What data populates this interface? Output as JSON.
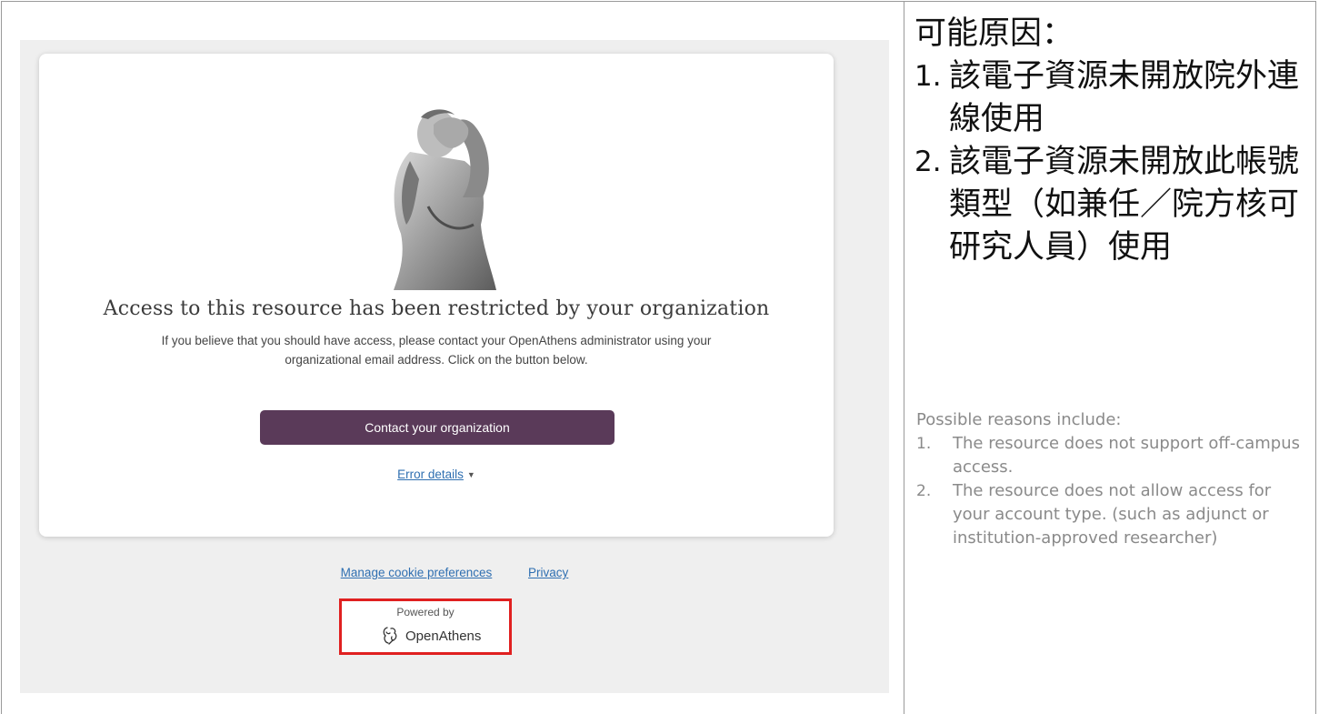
{
  "screenshot": {
    "headline": "Access to this resource has been restricted by your organization",
    "description_line1": "If you believe that you should have access, please contact your OpenAthens administrator using your",
    "description_line2": "organizational email address. Click on the button below.",
    "contact_button": "Contact your organization",
    "error_details": "Error details",
    "footer": {
      "cookie_link": "Manage cookie preferences",
      "privacy_link": "Privacy"
    },
    "powered_by": "Powered by",
    "brand": "OpenAthens"
  },
  "notes_zh": {
    "title": "可能原因：",
    "items": [
      {
        "num": "1.",
        "text": "該電子資源未開放院外連線使用"
      },
      {
        "num": "2.",
        "text": "該電子資源未開放此帳號類型（如兼任／院方核可研究人員）使用"
      }
    ]
  },
  "notes_en": {
    "title": "Possible reasons include:",
    "items": [
      {
        "num": "1.",
        "text": "The resource does not support off-campus access."
      },
      {
        "num": "2.",
        "text": "The resource does not allow access for your account type. (such as adjunct or institution-approved researcher)"
      }
    ]
  },
  "colors": {
    "button_bg": "#5a3a59",
    "link": "#2f6fb1",
    "highlight_box": "#e02020"
  }
}
